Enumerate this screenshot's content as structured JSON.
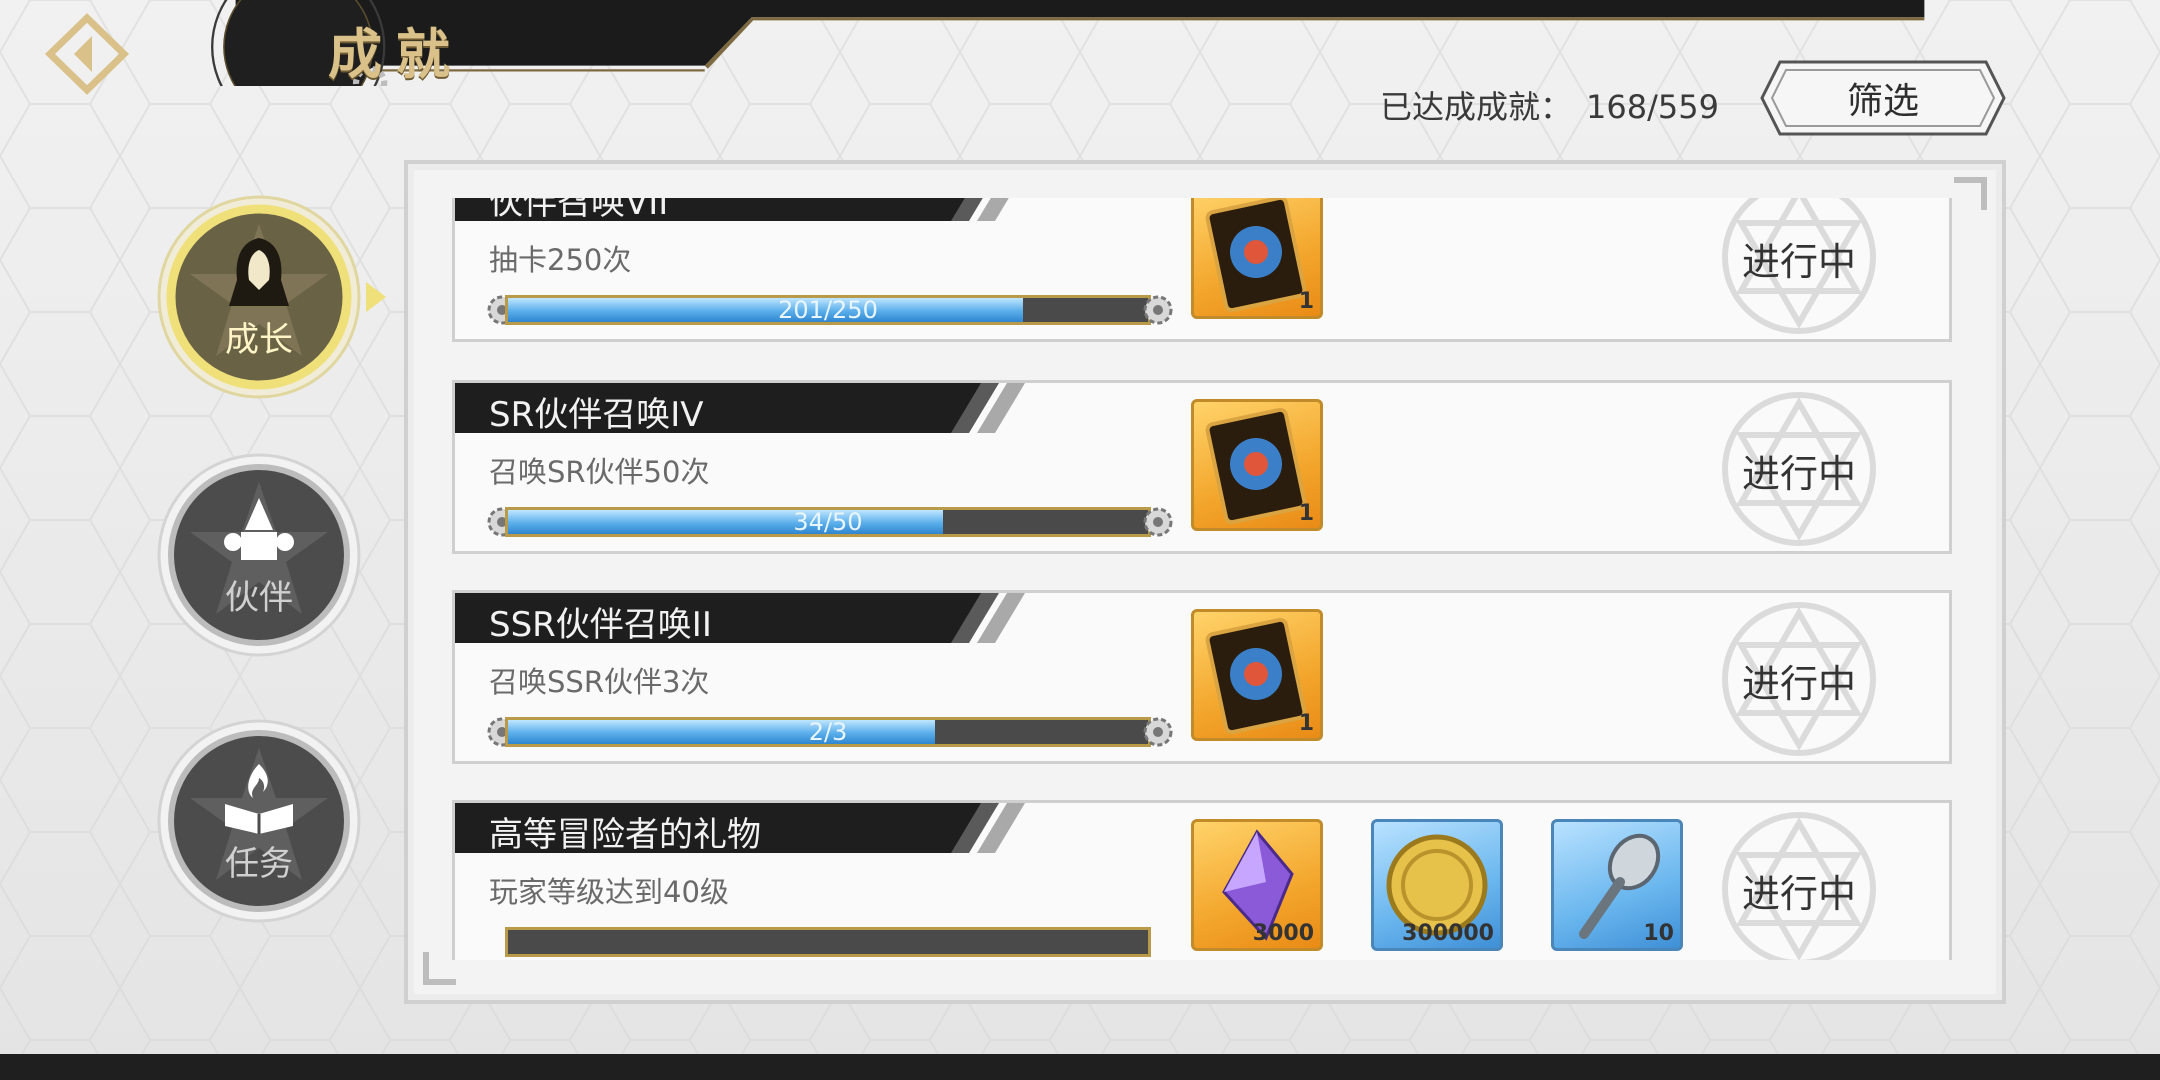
{
  "header": {
    "title": "成就"
  },
  "counter": {
    "label": "已达成成就：",
    "value": "168/559"
  },
  "filter": {
    "label": "筛选"
  },
  "nav": [
    {
      "label": "成长",
      "icon": "hooded-figure-icon",
      "active": true
    },
    {
      "label": "伙伴",
      "icon": "companions-icon",
      "active": false
    },
    {
      "label": "任务",
      "icon": "book-flame-icon",
      "active": false
    }
  ],
  "achievements": [
    {
      "name": "伙伴召唤VII",
      "desc": "抽卡250次",
      "progress": "201/250",
      "ratio": 0.804,
      "rewards": [
        {
          "icon": "summon-card-icon",
          "color": "orange",
          "qty": "1"
        }
      ],
      "status": "进行中"
    },
    {
      "name": "SR伙伴召唤IV",
      "desc": "召唤SR伙伴50次",
      "progress": "34/50",
      "ratio": 0.68,
      "rewards": [
        {
          "icon": "summon-card-icon",
          "color": "orange",
          "qty": "1"
        }
      ],
      "status": "进行中"
    },
    {
      "name": "SSR伙伴召唤II",
      "desc": "召唤SSR伙伴3次",
      "progress": "2/3",
      "ratio": 0.667,
      "rewards": [
        {
          "icon": "summon-card-icon",
          "color": "orange",
          "qty": "1"
        }
      ],
      "status": "进行中"
    },
    {
      "name": "高等冒险者的礼物",
      "desc": "玩家等级达到40级",
      "progress": "",
      "ratio": 0,
      "rewards": [
        {
          "icon": "purple-crystal-icon",
          "color": "orange",
          "qty": "3000"
        },
        {
          "icon": "gold-coin-icon",
          "color": "blue",
          "qty": "300000"
        },
        {
          "icon": "spoon-icon",
          "color": "blue",
          "qty": "10"
        }
      ],
      "status": "进行中"
    }
  ],
  "colors": {
    "accent_gold": "#d9c189",
    "progress_blue": "#5aaeea",
    "nav_active": "#e8d36a"
  }
}
